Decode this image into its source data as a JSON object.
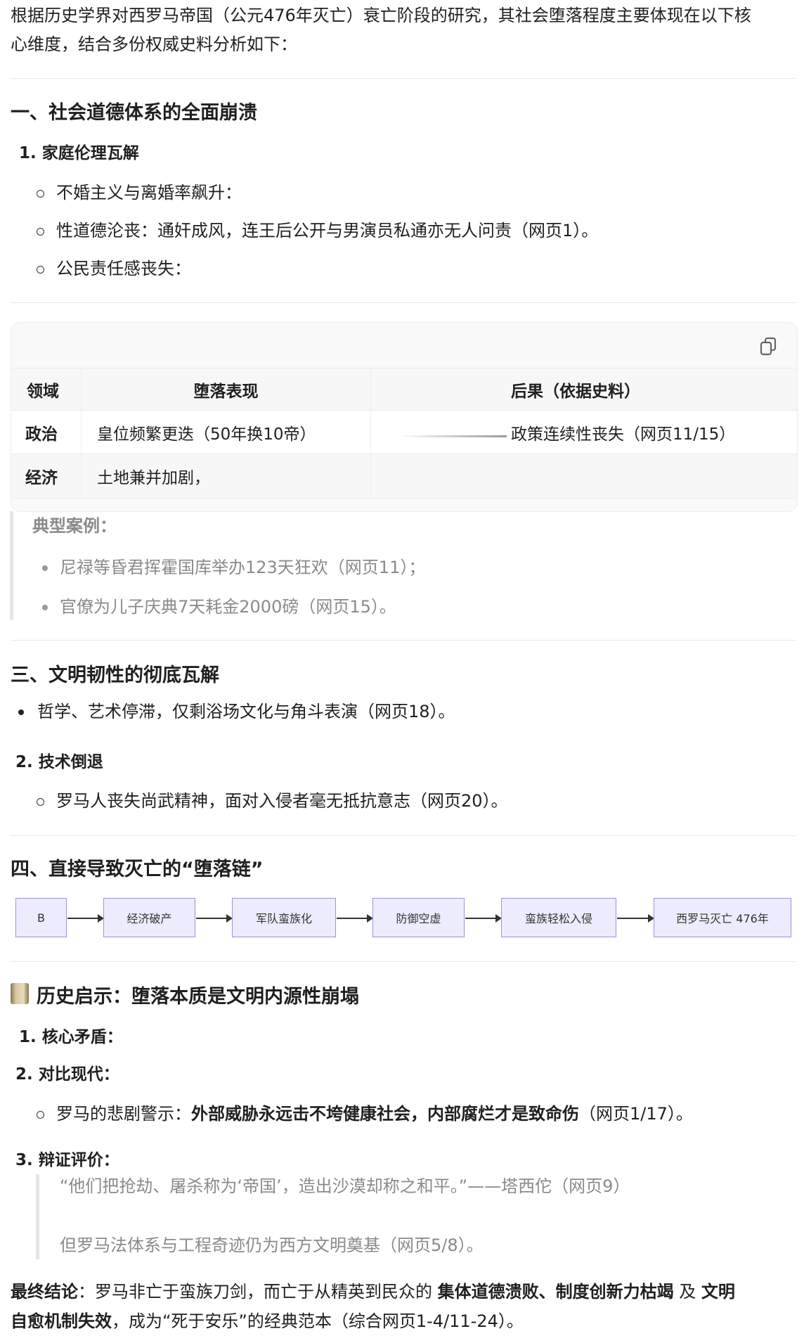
{
  "intro": [
    "根据历史学界对西罗马帝国（公元476年灭亡）衰亡阶段的研究，其社会堕落程度主要体现在以下核",
    "心维度，结合多份权威史料分析如下："
  ],
  "section1": {
    "title": "一、社会道德体系的全面崩溃",
    "sub1": "1. 家庭伦理瓦解",
    "bullets": [
      "不婚主义与离婚率飙升：",
      "性道德沦丧：通奸成风，连王后公开与男演员私通亦无人问责（网页1）。",
      "公民责任感丧失："
    ]
  },
  "table": {
    "copy_icon": "copy-icon",
    "headers": [
      "领域",
      "堕落表现",
      "后果（依据史料）"
    ],
    "rows": [
      [
        "政治",
        "皇位频繁更迭（50年换10帝）",
        "政策连续性丧失（网页11/15）"
      ],
      [
        "经济",
        "土地兼并加剧，",
        ""
      ]
    ]
  },
  "cases": {
    "title": "典型案例：",
    "items": [
      "尼禄等昏君挥霍国库举办123天狂欢（网页11）；",
      "官僚为儿子庆典7天耗金2000磅（网页15）。"
    ]
  },
  "section3": {
    "title": "三、文明韧性的彻底瓦解",
    "bullet": "哲学、艺术停滞，仅剩浴场文化与角斗表演（网页18）。",
    "sub2": "2. 技术倒退",
    "sub2_bullet": "罗马人丧失尚武精神，面对入侵者毫无抵抗意志（网页20）。"
  },
  "section4": {
    "title": "四、直接导致灭亡的“堕落链”",
    "flow": [
      "B",
      "经济破产",
      "军队蛮族化",
      "防御空虚",
      "蛮族轻松入侵",
      "西罗马灭亡 476年"
    ]
  },
  "lessons": {
    "icon": "scroll-icon",
    "title": "历史启示：堕落本质是文明内源性崩塌",
    "item1": "1. 核心矛盾：",
    "item2": "2. 对比现代：",
    "item2_bullet_prefix": "罗马的悲剧警示：",
    "item2_bullet_bold": "外部威胁永远击不垮健康社会，内部腐烂才是致命伤",
    "item2_bullet_suffix": "（网页1/17）。",
    "item3": "3. 辩证评价：",
    "quote1": "“他们把抢劫、屠杀称为‘帝国’，造出沙漠却称之和平。”——塔西佗（网页9）",
    "quote2": "但罗马法体系与工程奇迹仍为西方文明奠基（网页5/8）。"
  },
  "conclusion": {
    "label": "最终结论",
    "t1": "：罗马非亡于蛮族刀剑，而亡于从精英到民众的 ",
    "b1": "集体道德溃败、制度创新力枯竭",
    "t2": " 及 ",
    "b2": "文明",
    "b3": "自愈机制失效",
    "t3": "，成为“死于安乐”的经典范本（综合网页1-4/11-24）。"
  }
}
